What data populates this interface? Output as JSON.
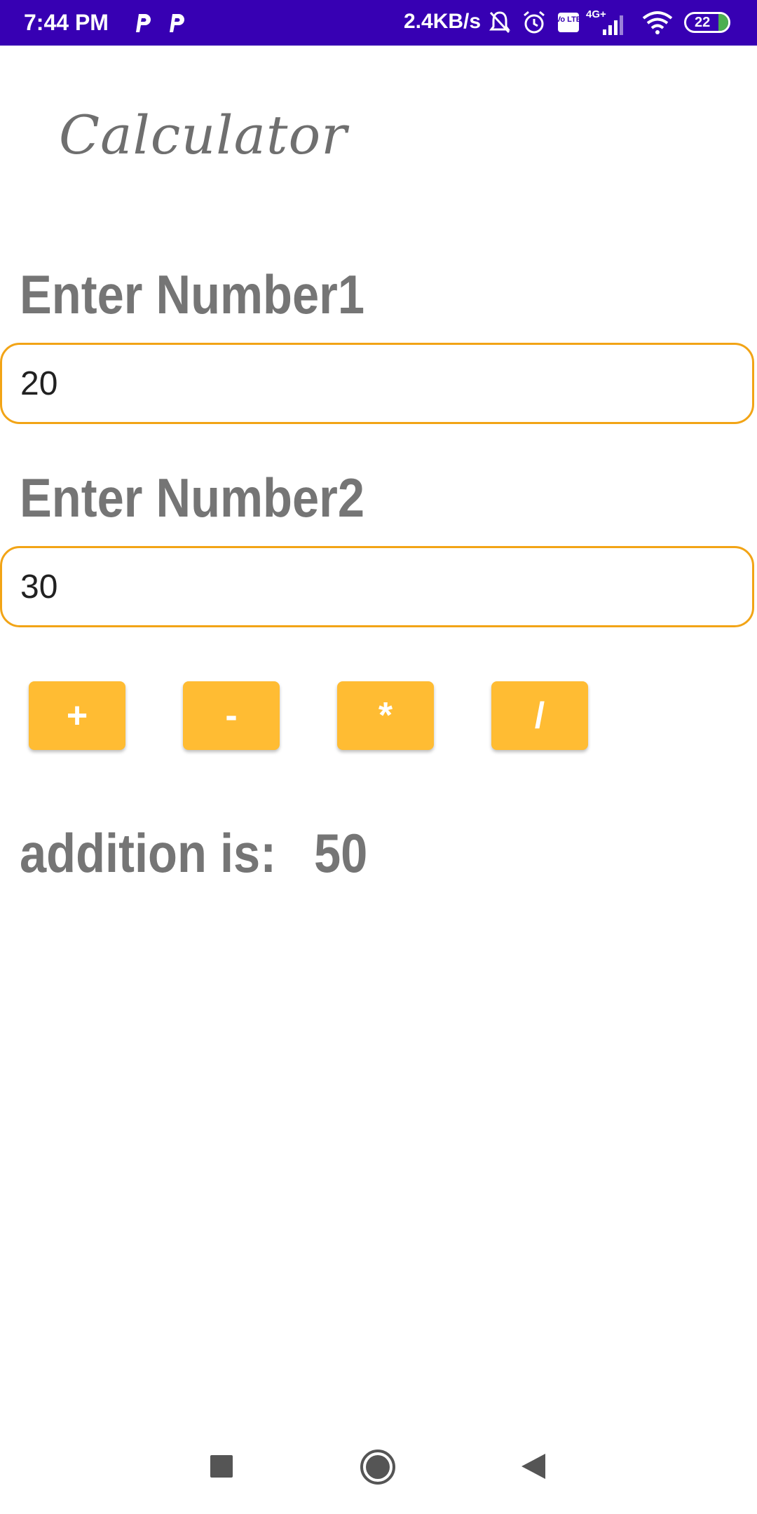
{
  "status_bar": {
    "time": "7:44 PM",
    "network_speed": "2.4KB/s",
    "network_type": "4G+",
    "volte": "Vo LTE",
    "battery": "22",
    "icons": [
      "p-notification-icon",
      "p-notification-icon",
      "mute-bell-icon",
      "alarm-icon",
      "volte-icon",
      "signal-icon",
      "wifi-icon",
      "battery-icon"
    ]
  },
  "app": {
    "title": "Calculator"
  },
  "form": {
    "number1": {
      "label": "Enter Number1",
      "value": "20"
    },
    "number2": {
      "label": "Enter Number2",
      "value": "30"
    }
  },
  "operations": [
    {
      "label": "+",
      "name": "add"
    },
    {
      "label": "-",
      "name": "subtract"
    },
    {
      "label": "*",
      "name": "multiply"
    },
    {
      "label": "/",
      "name": "divide"
    }
  ],
  "result": {
    "label": "addition is:",
    "value": "50"
  },
  "nav_bar": {
    "icons": [
      "recents-icon",
      "home-icon",
      "back-icon"
    ]
  },
  "colors": {
    "status_bar": "#3700b3",
    "button": "#ffbc33",
    "field_border": "#f2a416",
    "label_text": "#757575"
  }
}
